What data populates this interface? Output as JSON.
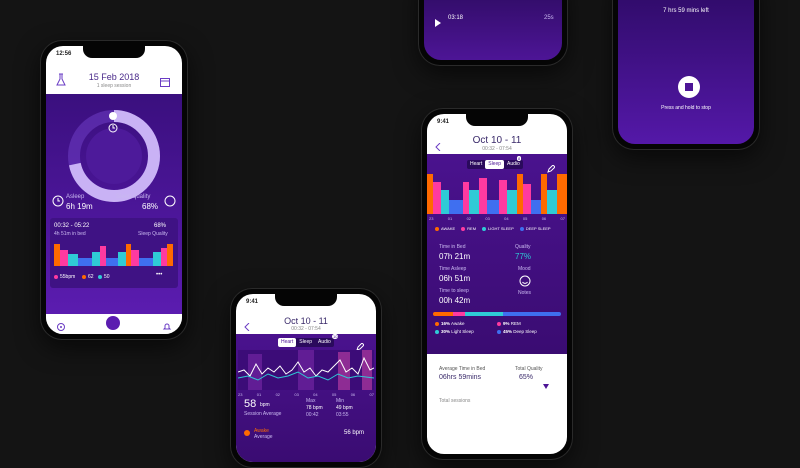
{
  "colors": {
    "purple": "#4d1596",
    "deep": "#2a0a5c",
    "accent": "#7b47d6",
    "awake": "#ff6a00",
    "rem": "#ff3aa0",
    "light": "#2fcbd6",
    "deep_sleep": "#3f6ff0"
  },
  "phone_top_left": {
    "time": "03:18",
    "remaining": "25s"
  },
  "phone_top_right": {
    "left_text": "7 hrs 59 mins left",
    "hint": "Press and hold to stop"
  },
  "phone1": {
    "status_time": "12:56",
    "date": "15 Feb 2018",
    "subtitle": "1 sleep session",
    "asleep_label": "Asleep",
    "asleep_value": "6h 19m",
    "quality_label": "Sleep quality",
    "quality_value": "68%",
    "session_time": "00:32 - 05:22",
    "in_bed": "4h 51m in bed",
    "session_quality": "68%",
    "session_quality_label": "Sleep Quality",
    "bpm_values": [
      "55bpm",
      "62",
      "50"
    ],
    "more": "•••"
  },
  "phone2": {
    "status_time": "9:41",
    "title": "Oct 10 - 11",
    "subtitle": "00:32 - 07:54",
    "tabs": [
      "Heart",
      "Sleep",
      "Audio"
    ],
    "badge": "10",
    "x_ticks": [
      "23",
      "01",
      "02",
      "03",
      "04",
      "05",
      "06",
      "07"
    ],
    "avg_value": "58",
    "avg_unit": "bpm",
    "avg_label": "Session Average",
    "max_label": "Max",
    "max_value": "78 bpm",
    "max_time": "00:42",
    "min_label": "Min",
    "min_value": "49 bpm",
    "min_time": "03:55",
    "awake_label": "Awake",
    "awake_sub": "Average",
    "awake_value": "56 bpm"
  },
  "phone3": {
    "status_time": "9:41",
    "title": "Oct 10 - 11",
    "subtitle": "00:32 - 07:54",
    "tabs": [
      "Heart",
      "Sleep",
      "Audio"
    ],
    "badge": "8",
    "x_ticks": [
      "23",
      "01",
      "02",
      "03",
      "04",
      "05",
      "06",
      "07"
    ],
    "legend": [
      "AWAKE",
      "REM",
      "LIGHT SLEEP",
      "DEEP SLEEP"
    ],
    "time_in_bed_label": "Time in Bed",
    "time_in_bed": "07h 21m",
    "quality_label": "Quality",
    "quality": "77%",
    "time_asleep_label": "Time Asleep",
    "time_asleep": "06h 51m",
    "mood_label": "Mood",
    "time_to_sleep_label": "Time to sleep",
    "time_to_sleep": "00h 42m",
    "notes_label": "Notes",
    "stages": [
      {
        "pct": "16%",
        "name": "Awake"
      },
      {
        "pct": "9%",
        "name": "REM"
      },
      {
        "pct": "30%",
        "name": "Light Sleep"
      },
      {
        "pct": "45%",
        "name": "Deep Sleep"
      }
    ],
    "avg_in_bed_label": "Average Time in Bed",
    "avg_in_bed": "06hrs 59mins",
    "total_quality_label": "Total Quality",
    "total_quality": "65%",
    "total_sessions": "Total sessions"
  }
}
